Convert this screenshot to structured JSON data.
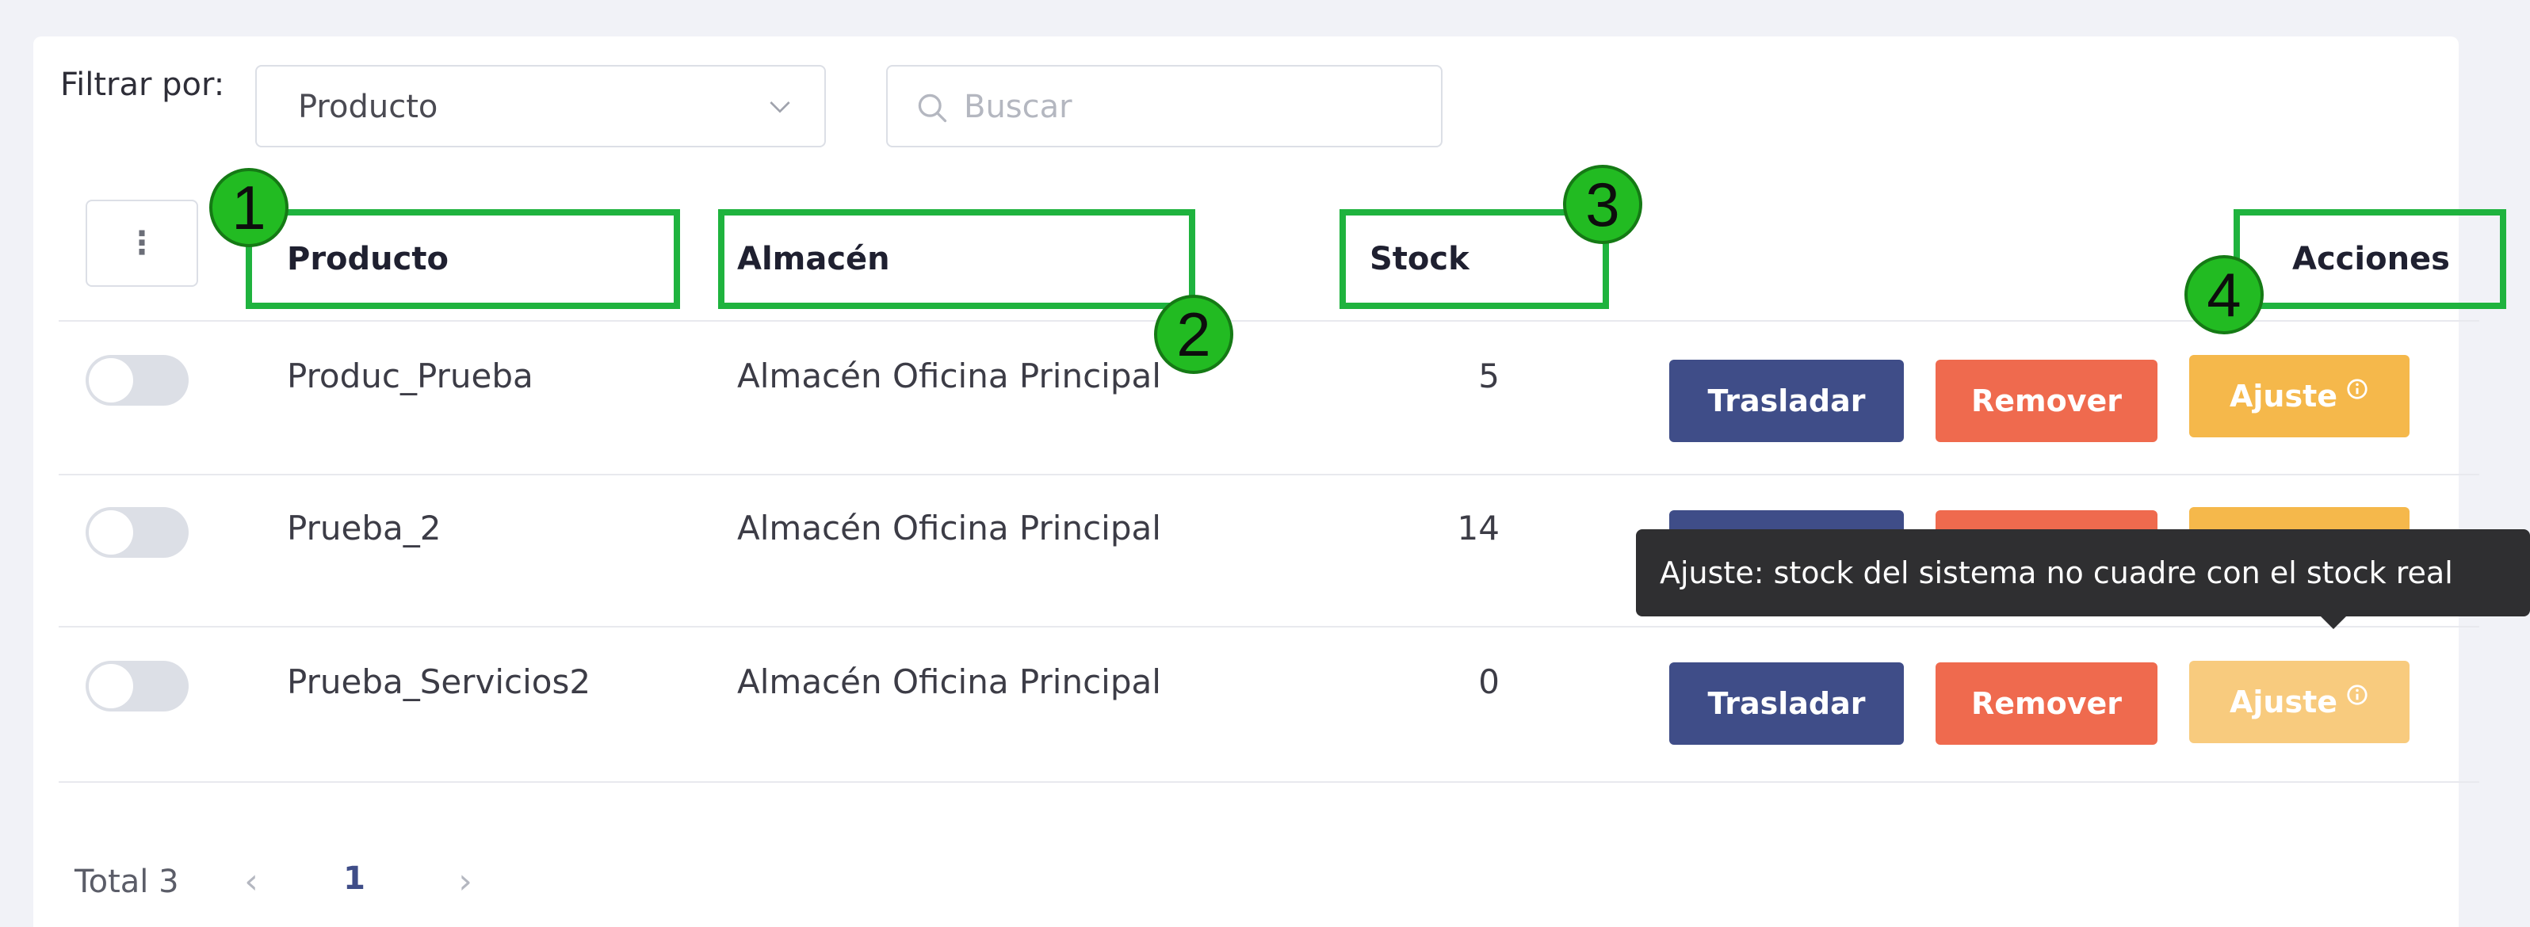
{
  "filter": {
    "label": "Filtrar por:",
    "select_value": "Producto",
    "search_placeholder": "Buscar"
  },
  "table": {
    "col_menu_icon": "⋮",
    "headers": {
      "producto": "Producto",
      "almacen": "Almacén",
      "stock": "Stock",
      "acciones": "Acciones"
    },
    "rows": [
      {
        "producto": "Produc_Prueba",
        "almacen": "Almacén Oficina Principal",
        "stock": "5",
        "enabled": false
      },
      {
        "producto": "Prueba_2",
        "almacen": "Almacén Oficina Principal",
        "stock": "14",
        "enabled": false
      },
      {
        "producto": "Prueba_Servicios2",
        "almacen": "Almacén Oficina Principal",
        "stock": "0",
        "enabled": false
      }
    ],
    "actions": {
      "trasladar": "Trasladar",
      "remover": "Remover",
      "ajuste": "Ajuste"
    }
  },
  "tooltip": {
    "text": "Ajuste: stock del sistema no cuadre con el stock real"
  },
  "pagination": {
    "total": "Total 3",
    "current_page": "1"
  },
  "annotations": [
    "1",
    "2",
    "3",
    "4"
  ],
  "colors": {
    "trasladar": "#3f4d88",
    "remover": "#ef6a4e",
    "ajuste": "#f5b84b",
    "annotation": "#1fb33e"
  },
  "icons": {
    "select": "chevron-down-icon",
    "search": "search-icon",
    "info": "info-circle-icon",
    "prev": "chevron-left-icon",
    "next": "chevron-right-icon"
  }
}
